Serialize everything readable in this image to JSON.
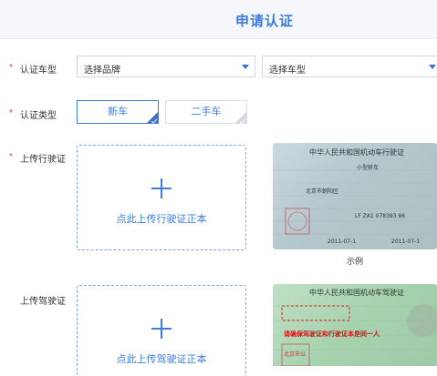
{
  "header": {
    "title": "申请认证"
  },
  "form": {
    "required_mark": "*",
    "brand_row": {
      "label": "认证车型",
      "brand_placeholder": "选择品牌",
      "model_placeholder": "选择车型"
    },
    "type_row": {
      "label": "认证类型",
      "options": [
        {
          "label": "新车",
          "selected": true
        },
        {
          "label": "二手车",
          "selected": false
        }
      ]
    },
    "license_row": {
      "label": "上传行驶证",
      "upload_text": "点此上传行驶证正本",
      "sample_caption": "示例",
      "sample_title": "中华人民共和国机动车行驶证",
      "sample_lines": [
        "小型轿车",
        "北京市朝阳区",
        "LF ZA1 078393 86",
        "2011-07-1",
        "2011-07-1"
      ]
    },
    "driver_row": {
      "label": "上传驾驶证",
      "upload_text": "点此上传驾驶证正本",
      "sample_title": "中华人民共和国机动车驾驶证",
      "sample_warning": "请确保驾驶证和行驶证本是同一人",
      "sample_lines": [
        "北京市公"
      ]
    }
  },
  "colors": {
    "accent": "#3d7cd9",
    "required": "#e0443a",
    "header_bg": "#f4f6f9"
  },
  "icons": {
    "dropdown": "chevron-down-icon",
    "upload": "plus-icon",
    "selected_corner": "check-corner-icon"
  }
}
